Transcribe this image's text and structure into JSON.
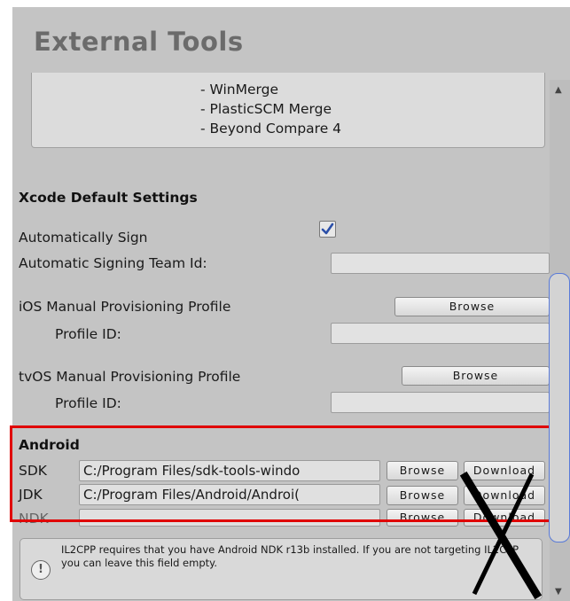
{
  "title": "External Tools",
  "merge_tools": [
    "- WinMerge",
    "- PlasticSCM Merge",
    "- Beyond Compare 4"
  ],
  "xcode": {
    "heading": "Xcode Default Settings",
    "auto_sign_label": "Automatically Sign",
    "auto_sign_checked": true,
    "team_id_label": "Automatic Signing Team Id:",
    "ios_profile_label": "iOS Manual Provisioning Profile",
    "ios_profile_id_label": "Profile ID:",
    "tvos_profile_label": "tvOS Manual Provisioning Profile",
    "tvos_profile_id_label": "Profile ID:",
    "browse_label": "Browse"
  },
  "android": {
    "heading": "Android",
    "rows": [
      {
        "label": "SDK",
        "value": "C:/Program Files/sdk-tools-windo",
        "browse": "Browse",
        "download": "Download"
      },
      {
        "label": "JDK",
        "value": "C:/Program Files/Android/Androi(",
        "browse": "Browse",
        "download": "Download"
      },
      {
        "label": "NDK",
        "value": "",
        "browse": "Browse",
        "download": "Download"
      }
    ],
    "info_text": "IL2CPP requires that you have Android NDK r13b installed. If you are not targeting IL2CPP you can leave this field empty."
  },
  "icons": {
    "checkmark": "checkmark-icon",
    "info": "info-icon",
    "scroll_up": "scroll-up-arrow-icon",
    "scroll_down": "scroll-down-arrow-icon"
  },
  "colors": {
    "highlight": "#e00000",
    "scroll_thumb_border": "#5a7bd8",
    "checkmark": "#2b4fa8"
  }
}
